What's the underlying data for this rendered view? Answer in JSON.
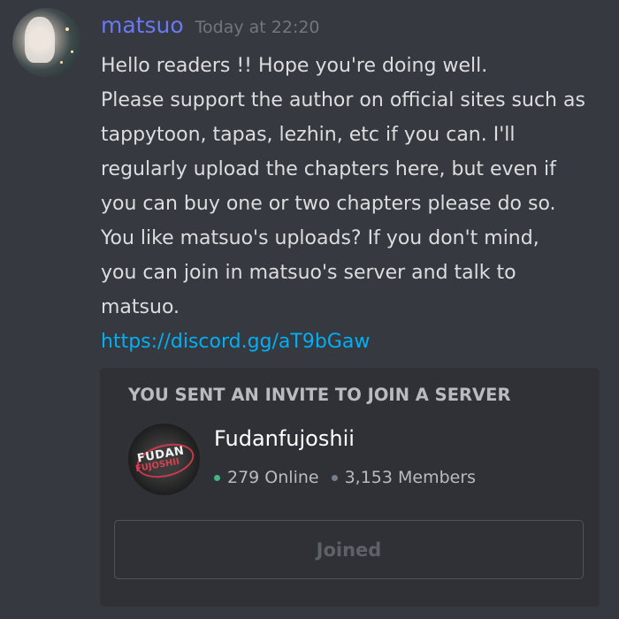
{
  "message": {
    "username": "matsuo",
    "timestamp": "Today at 22:20",
    "lines": [
      "Hello readers !! Hope you're doing well.",
      "Please support the author on official sites such as",
      "tappytoon, tapas, lezhin, etc if you can. I'll",
      "regularly upload the chapters here, but even if",
      "you can buy one or two chapters please do so.",
      "You like matsuo's uploads? If you don't mind,",
      "you can join in matsuo's server and talk to",
      "matsuo."
    ],
    "link": "https://discord.gg/aT9bGaw",
    "avatar_icon": "user-avatar-icon"
  },
  "invite": {
    "title": "YOU SENT AN INVITE TO JOIN A SERVER",
    "server_name": "Fudanfujoshii",
    "server_icon_text_1": "FUDAN",
    "server_icon_text_2": "FUJOSHII",
    "online": "279 Online",
    "members": "3,153 Members",
    "button_label": "Joined"
  },
  "colors": {
    "background": "#36393f",
    "username": "#6979f4",
    "link": "#00aff4",
    "online_dot": "#43b581",
    "card": "#2f3136"
  }
}
